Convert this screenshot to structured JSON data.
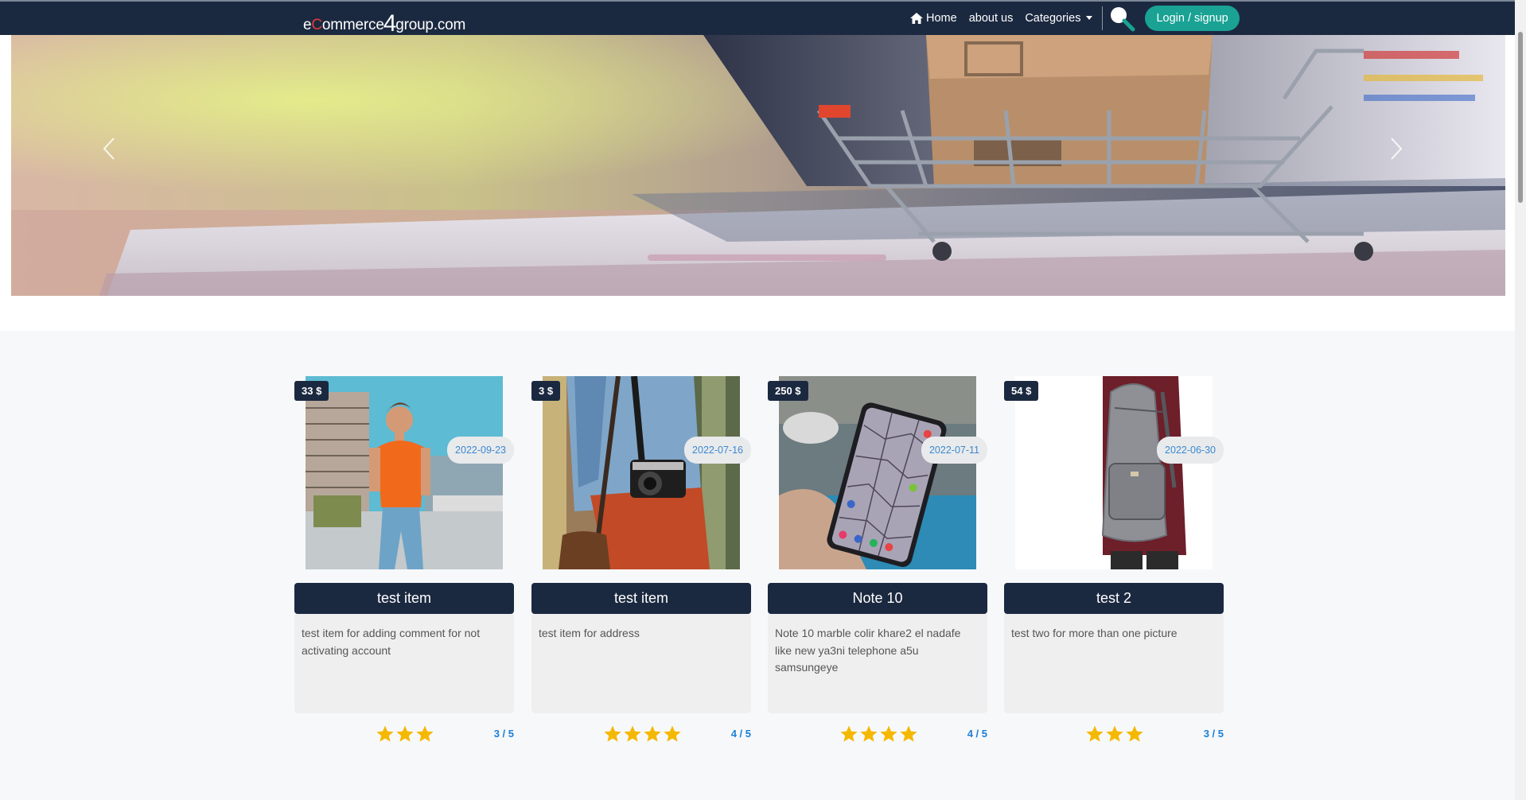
{
  "nav": {
    "brand": {
      "part1": "e",
      "part2": "C",
      "part3": "ommerce",
      "part4": "4",
      "part5": "group.com"
    },
    "home": "Home",
    "about": "about us",
    "categories": "Categories",
    "login": "Login / signup"
  },
  "products": [
    {
      "price": "33 $",
      "title": "test item",
      "description": "test item for adding comment for not activating account",
      "rating_stars": 3,
      "rating_text": "3 / 5",
      "date": "2022-09-23"
    },
    {
      "price": "3 $",
      "title": "test item",
      "description": "test item for address",
      "rating_stars": 4,
      "rating_text": "4 / 5",
      "date": "2022-07-16"
    },
    {
      "price": "250 $",
      "title": "Note 10",
      "description": "Note 10 marble colir khare2 el nadafe like new ya3ni telephone a5u samsungeye",
      "rating_stars": 4,
      "rating_text": "4 / 5",
      "date": "2022-07-11"
    },
    {
      "price": "54 $",
      "title": "test 2",
      "description": "test two for more than one picture",
      "rating_stars": 3,
      "rating_text": "3 / 5",
      "date": "2022-06-30"
    }
  ],
  "colors": {
    "navbar": "#1b2940",
    "accent": "#1aa294",
    "star": "#f5b800",
    "rating_text": "#1a7fd6"
  }
}
